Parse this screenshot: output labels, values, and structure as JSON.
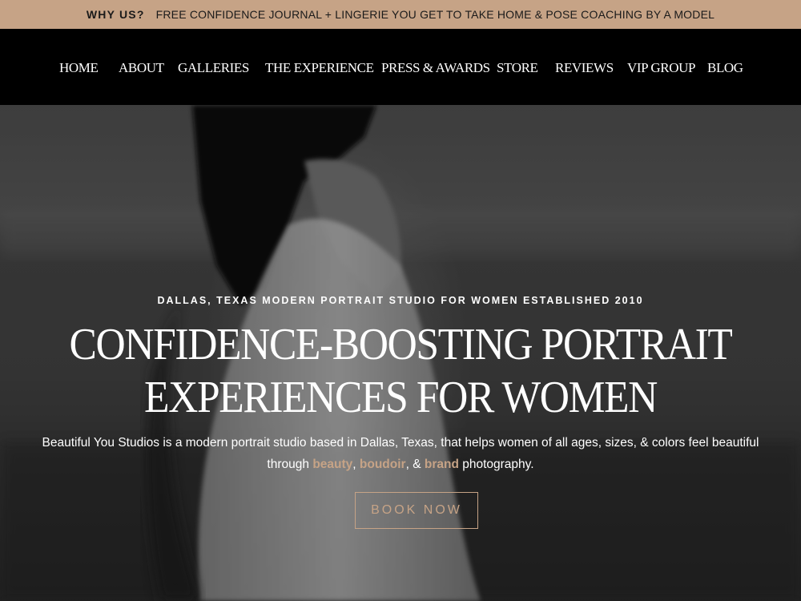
{
  "promo": {
    "label": "WHY US?",
    "text": "FREE CONFIDENCE JOURNAL + LINGERIE YOU GET TO TAKE HOME & POSE COACHING BY A MODEL"
  },
  "nav": {
    "items": [
      {
        "label": "HOME"
      },
      {
        "label": "ABOUT"
      },
      {
        "label": "GALLERIES"
      },
      {
        "label": "THE EXPERIENCE"
      },
      {
        "label": "PRESS & AWARDS"
      },
      {
        "label": "STORE"
      },
      {
        "label": "REVIEWS"
      },
      {
        "label": "VIP GROUP"
      },
      {
        "label": "BLOG"
      }
    ]
  },
  "hero": {
    "eyebrow": "DALLAS, TEXAS MODERN PORTRAIT STUDIO FOR WOMEN ESTABLISHED 2010",
    "title_line1": "CONFIDENCE-BOOSTING PORTRAIT",
    "title_line2": "EXPERIENCES FOR WOMEN",
    "desc_part1": "Beautiful You Studios is a modern portrait studio based in Dallas, Texas, that helps women of all ages, sizes, & colors feel beautiful through ",
    "desc_link1": "beauty",
    "desc_sep1": ", ",
    "desc_link2": "boudoir",
    "desc_sep2": ", & ",
    "desc_link3": "brand",
    "desc_part2": " photography.",
    "button_label": "BOOK NOW"
  },
  "colors": {
    "accent": "#c6a386",
    "nav_background": "#000000",
    "text": "#ffffff"
  }
}
